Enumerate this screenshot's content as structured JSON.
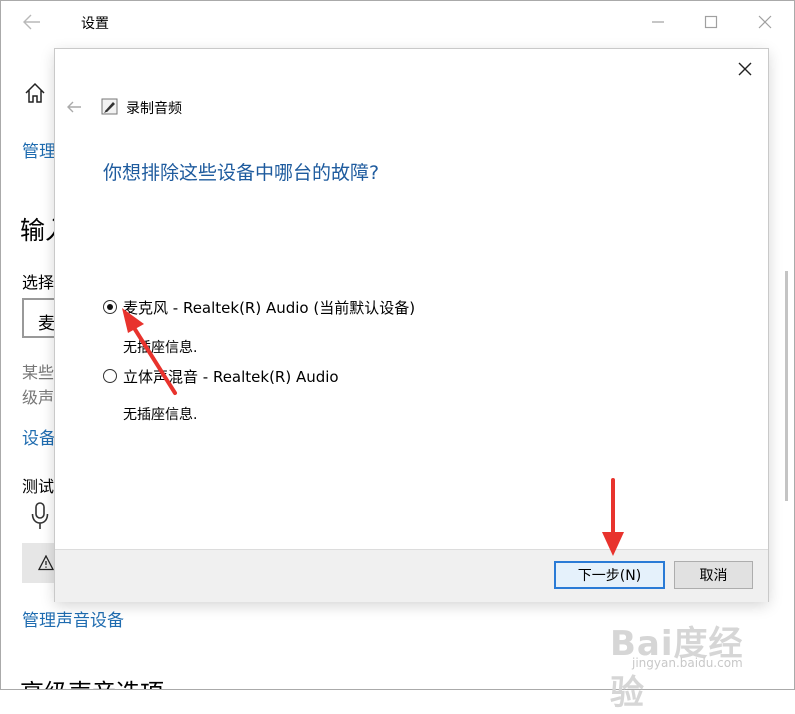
{
  "settings_window": {
    "title": "设置",
    "links": {
      "manage_top": "管理",
      "device": "设备",
      "manage_sound_devices": "管理声音设备"
    },
    "section_input": "输入",
    "choose_label": "选择",
    "select_value": "麦",
    "gray_line1": "某些",
    "gray_line2": "级声",
    "test_label": "测试",
    "section_advanced": "高级声音选项"
  },
  "dialog": {
    "app_title": "录制音频",
    "question": "你想排除这些设备中哪台的故障?",
    "options": [
      {
        "label": "麦克风 - Realtek(R) Audio (当前默认设备)",
        "sub": "无插座信息.",
        "selected": true
      },
      {
        "label": "立体声混音 - Realtek(R) Audio",
        "sub": "无插座信息.",
        "selected": false
      }
    ],
    "buttons": {
      "next": "下一步(N)",
      "cancel": "取消"
    }
  },
  "watermark": {
    "main": "Bai度经验",
    "sub": "jingyan.baidu.com"
  },
  "colors": {
    "link": "#1f6cb0",
    "question": "#1e5b9e",
    "accent": "#2a7bd6",
    "arrow": "#e8332d"
  },
  "icons": [
    "back-arrow-icon",
    "minimize-icon",
    "maximize-icon",
    "close-icon",
    "home-icon",
    "microphone-icon",
    "warning-icon",
    "recording-app-icon"
  ]
}
